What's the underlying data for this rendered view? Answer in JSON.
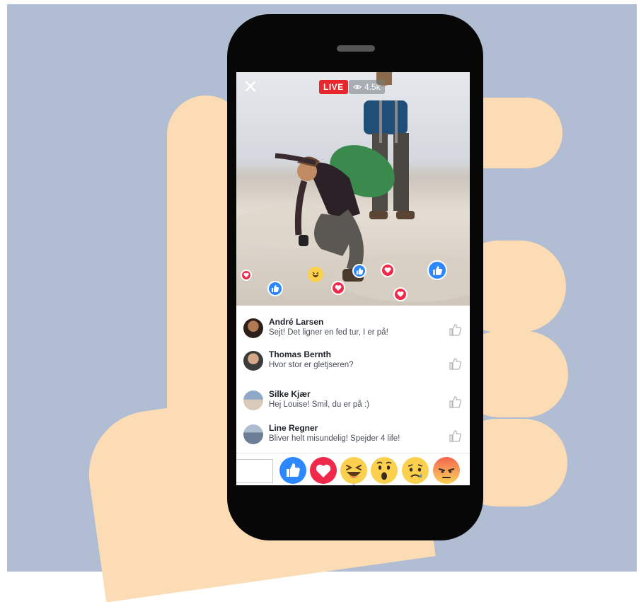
{
  "live_video": {
    "live_badge": "LIVE",
    "viewer_count": "4.5k",
    "close_icon": "close-icon"
  },
  "floating_reactions": [
    "like",
    "love",
    "haha",
    "like",
    "love",
    "love",
    "love",
    "like"
  ],
  "comments": [
    {
      "name": "André Larsen",
      "text": "Sejt! Det ligner en fed tur, I er på!"
    },
    {
      "name": "Thomas Bernth",
      "text": "Hvor stor er gletjseren?"
    },
    {
      "name": "Silke Kjær",
      "text": "Hej Louise! Smil, du er på :)"
    },
    {
      "name": "Line Regner",
      "text": "Bliver helt misundelig! Spejder 4 life!"
    }
  ],
  "reaction_bar": [
    "like",
    "love",
    "haha",
    "wow",
    "sad",
    "angry"
  ],
  "colors": {
    "background": "#b0bdd2",
    "skin": "#fcdcb5",
    "phone": "#070707",
    "live_red": "#e8262b",
    "like_blue": "#2d88ff",
    "love_red": "#f0284a",
    "emoji_yellow": "#fcd04f",
    "angry_red": "#f2654a"
  }
}
